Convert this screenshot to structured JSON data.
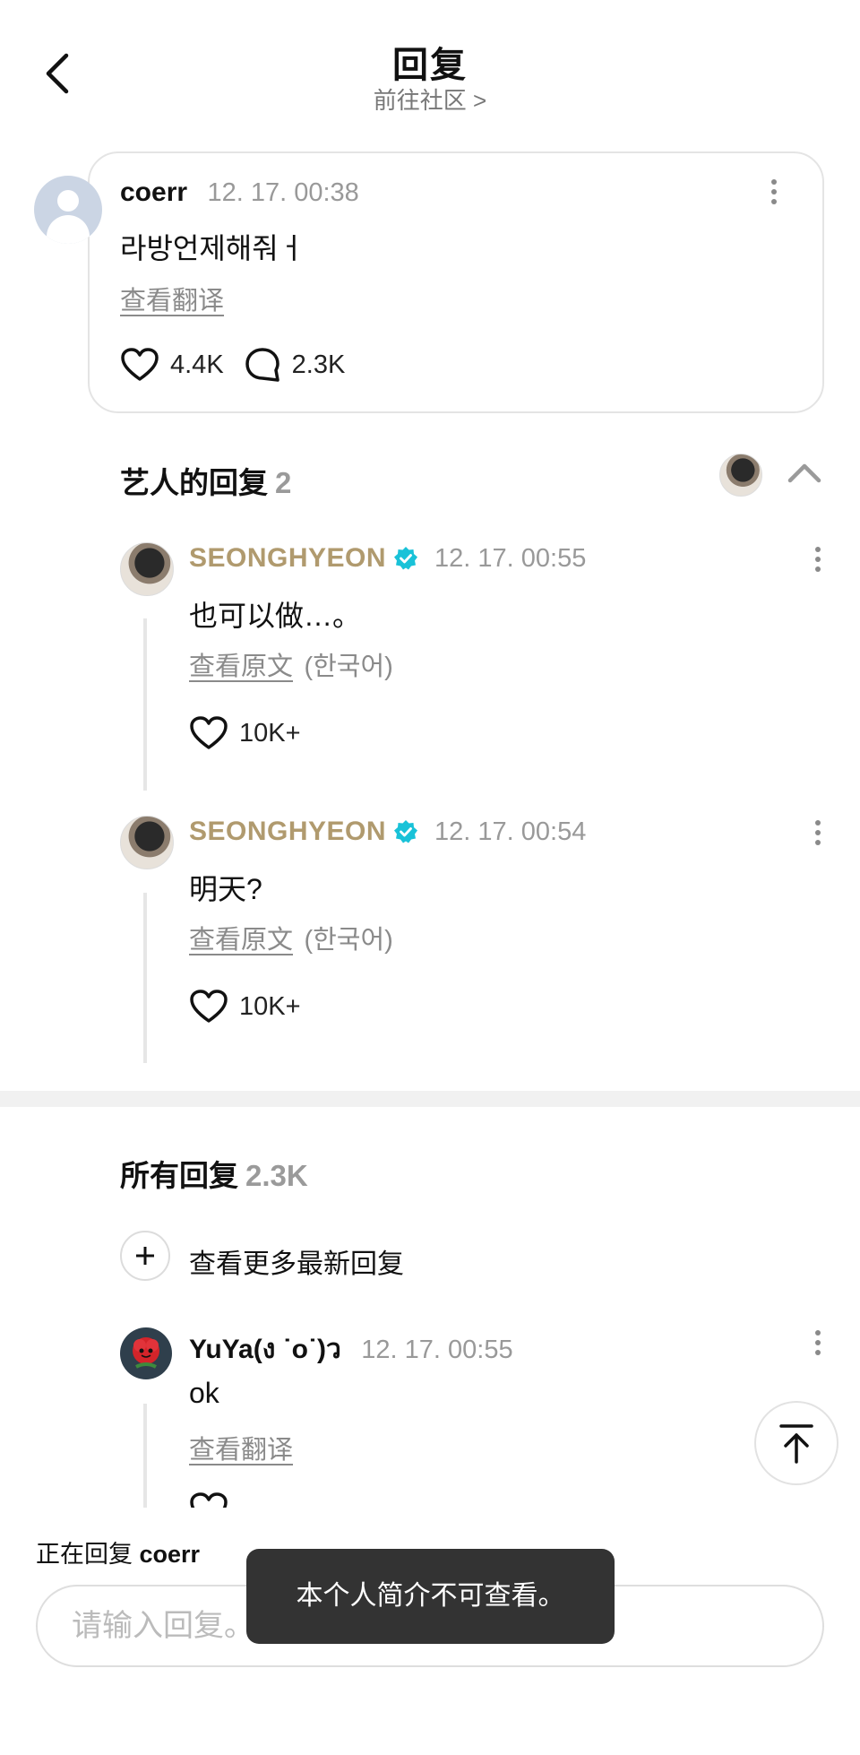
{
  "header": {
    "title": "回复",
    "subtitle": "前往社区 >"
  },
  "original_comment": {
    "author": "coerr",
    "time": "12. 17. 00:38",
    "text": "라방언제해줘ㅓ",
    "translate_label": "查看翻译",
    "like_count": "4.4K",
    "reply_count": "2.3K"
  },
  "artist_replies": {
    "title": "艺人的回复",
    "count": "2",
    "items": [
      {
        "author": "SEONGHYEON",
        "time": "12. 17. 00:55",
        "text": "也可以做…。",
        "view_original_label": "查看原文",
        "language": "(한국어)",
        "like_count": "10K+"
      },
      {
        "author": "SEONGHYEON",
        "time": "12. 17. 00:54",
        "text": "明天?",
        "view_original_label": "查看原文",
        "language": "(한국어)",
        "like_count": "10K+"
      }
    ]
  },
  "all_replies": {
    "title": "所有回复",
    "count": "2.3K",
    "see_more_label": "查看更多最新回复",
    "items": [
      {
        "author": "YuYa(ง ˙o˙)ว",
        "time": "12. 17. 00:55",
        "text": "ok",
        "translate_label": "查看翻译"
      }
    ]
  },
  "reply_bar": {
    "replying_prefix": "正在回复",
    "replying_to": "coerr",
    "placeholder": "请输入回复。"
  },
  "toast": {
    "message": "本个人简介不可查看。"
  },
  "colors": {
    "artist_name": "#b09a6e",
    "verified_badge": "#19c2d8",
    "toast_bg": "#333333"
  }
}
